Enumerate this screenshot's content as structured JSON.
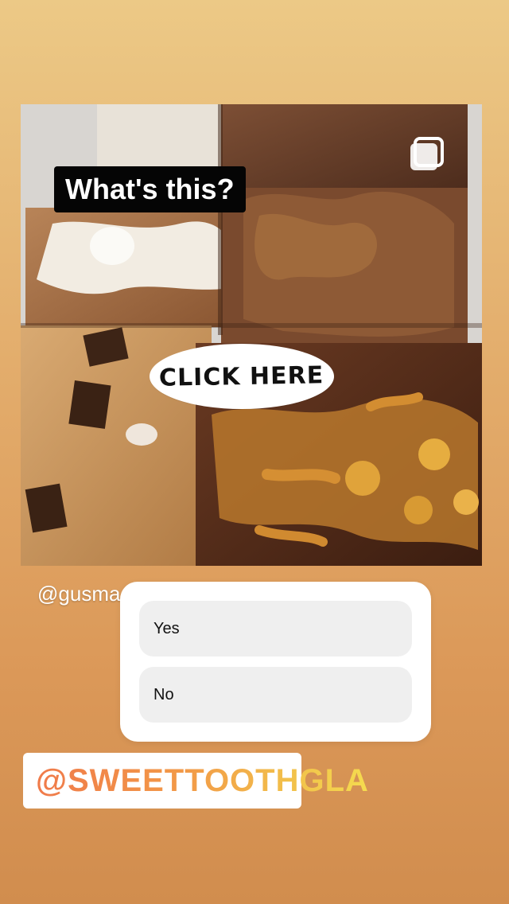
{
  "story": {
    "title_sticker": "What's this?",
    "click_sticker": "CLICK HERE",
    "mention_under_photo": "@gusma",
    "mention_sticker": "@SWEETTOOTHGLA"
  },
  "poll": {
    "options": [
      {
        "label": "Yes"
      },
      {
        "label": "No"
      }
    ]
  },
  "icons": {
    "multi_post": "multiple-posts-icon"
  },
  "colors": {
    "bg_top": "#ecc986",
    "bg_bottom": "#d18d4e",
    "mention_gradient_start": "#f07a4a",
    "mention_gradient_end": "#f5dc4f"
  }
}
